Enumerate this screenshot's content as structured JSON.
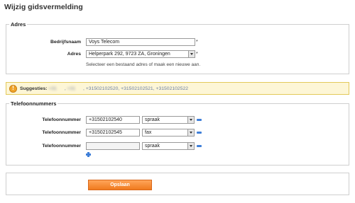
{
  "page": {
    "title": "Wijzig gidsvermelding"
  },
  "address_section": {
    "legend": "Adres",
    "company_label": "Bedrijfsnaam",
    "company_value": "Voys Telecom",
    "address_label": "Adres",
    "address_value": "Helperpark 292, 9723 ZA, Groningen",
    "address_hint": "Selecteer een bestaand adres of maak een nieuwe aan.",
    "required_mark": "*"
  },
  "suggestions": {
    "label": "Suggesties:",
    "blurred": [
      "+31        ",
      "+31        "
    ],
    "visible": "+31502102520, +31502102521, +31502102522"
  },
  "phone_section": {
    "legend": "Telefoonnummers",
    "rows": [
      {
        "label": "Telefoonnummer",
        "number": "+31502102540",
        "type": "spraak"
      },
      {
        "label": "Telefoonnummer",
        "number": "+31502102545",
        "type": "fax"
      },
      {
        "label": "Telefoonnummer",
        "number": "",
        "type": "spraak"
      }
    ]
  },
  "actions": {
    "save_label": "Opslaan"
  },
  "colors": {
    "accent_button": "#f07a1e",
    "icon_blue": "#3f7fd8",
    "suggest_bg": "#fdf6d6"
  }
}
